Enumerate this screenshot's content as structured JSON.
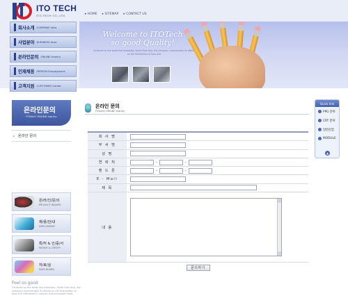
{
  "brand": {
    "name": "ITO TECH",
    "sub": "ITO-TECH CO.,LTD"
  },
  "topnav": [
    "HOME",
    "SITEMAP",
    "CONTACT US"
  ],
  "menu": [
    {
      "ko": "회사소개",
      "en": "COMPANY Intro"
    },
    {
      "ko": "사업분야",
      "en": "BUSINESS Area"
    },
    {
      "ko": "온라인문의",
      "en": "ONLINE Inquiry"
    },
    {
      "ko": "인재채용",
      "en": "PERSON Employment"
    },
    {
      "ko": "고객지원",
      "en": "CUSTOMER Center"
    }
  ],
  "banner": {
    "line1": "Welcome to ITOTech",
    "line2": "so good Quality!",
    "desc": "Centered on the areas like Indonesia, South East Asia, the company concentrates its efforts on the distribution of tops and"
  },
  "sidebar": {
    "title": "온라인문의",
    "title_en": "ITOtech ONLINE Inquiry",
    "menu_item": "온라인 문의"
  },
  "quick_links": [
    {
      "t1": "온/라/인/문/의",
      "t2": "PRODUCT INQUIRY",
      "color": "#3b4a6b"
    },
    {
      "t1": "채/용/안/내",
      "t2": "EMPLOYMENT",
      "color": "#3aa7d4"
    },
    {
      "t1": "특/허 & 인/증/서",
      "t2": "PATENT & CERTIFY",
      "color": "#6e6e6e"
    },
    {
      "t1": "자/료/실",
      "t2": "DATA BOARD",
      "color": "#d86bc2"
    }
  ],
  "footer": {
    "title": "Feel so good",
    "text": "Centered on the areas like Indonesia, South East Asia, the company concentrates its efforts on the distribution of tops and interested in colorize and processed foods"
  },
  "page": {
    "title": "온라인 문의",
    "subtitle": "ITOtech ONLINE Inquiry"
  },
  "form": {
    "labels": [
      "회 사 명",
      "부 서 명",
      "성 명",
      "연 락 처",
      "핸 드 폰",
      "E - Mail",
      "제 목",
      "내 용"
    ],
    "dash": "-",
    "submit": "문의하기"
  },
  "quick": {
    "header": "Quick link",
    "items": [
      "PPG 분야",
      "CRT 분야",
      "일반산업",
      "MODULE"
    ],
    "top": "▲"
  }
}
